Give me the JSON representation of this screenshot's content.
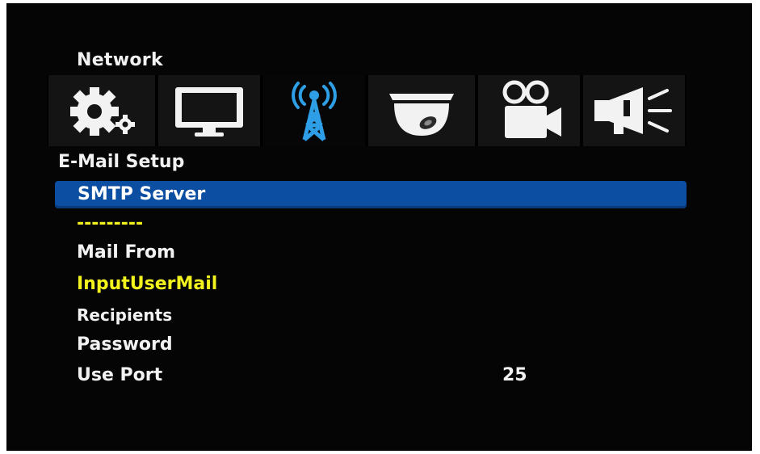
{
  "section": {
    "title": "Network"
  },
  "icons": [
    {
      "name": "gear-icon",
      "active": false
    },
    {
      "name": "monitor-icon",
      "active": false
    },
    {
      "name": "antenna-icon",
      "active": true
    },
    {
      "name": "dome-camera-icon",
      "active": false
    },
    {
      "name": "video-camera-icon",
      "active": false
    },
    {
      "name": "megaphone-icon",
      "active": false
    }
  ],
  "menu": {
    "title": "E-Mail Setup",
    "smtp_server_label": "SMTP Server",
    "smtp_server_value": "---------",
    "mail_from_label": "Mail From",
    "mail_from_value": "InputUserMail",
    "recipients_label": "Recipients",
    "password_label": "Password",
    "use_port_label": "Use Port",
    "use_port_value": "25"
  },
  "colors": {
    "highlight": "#0c4ea2",
    "value_text": "#f3f31e",
    "active_icon": "#2e9fe6",
    "background": "#050505"
  }
}
